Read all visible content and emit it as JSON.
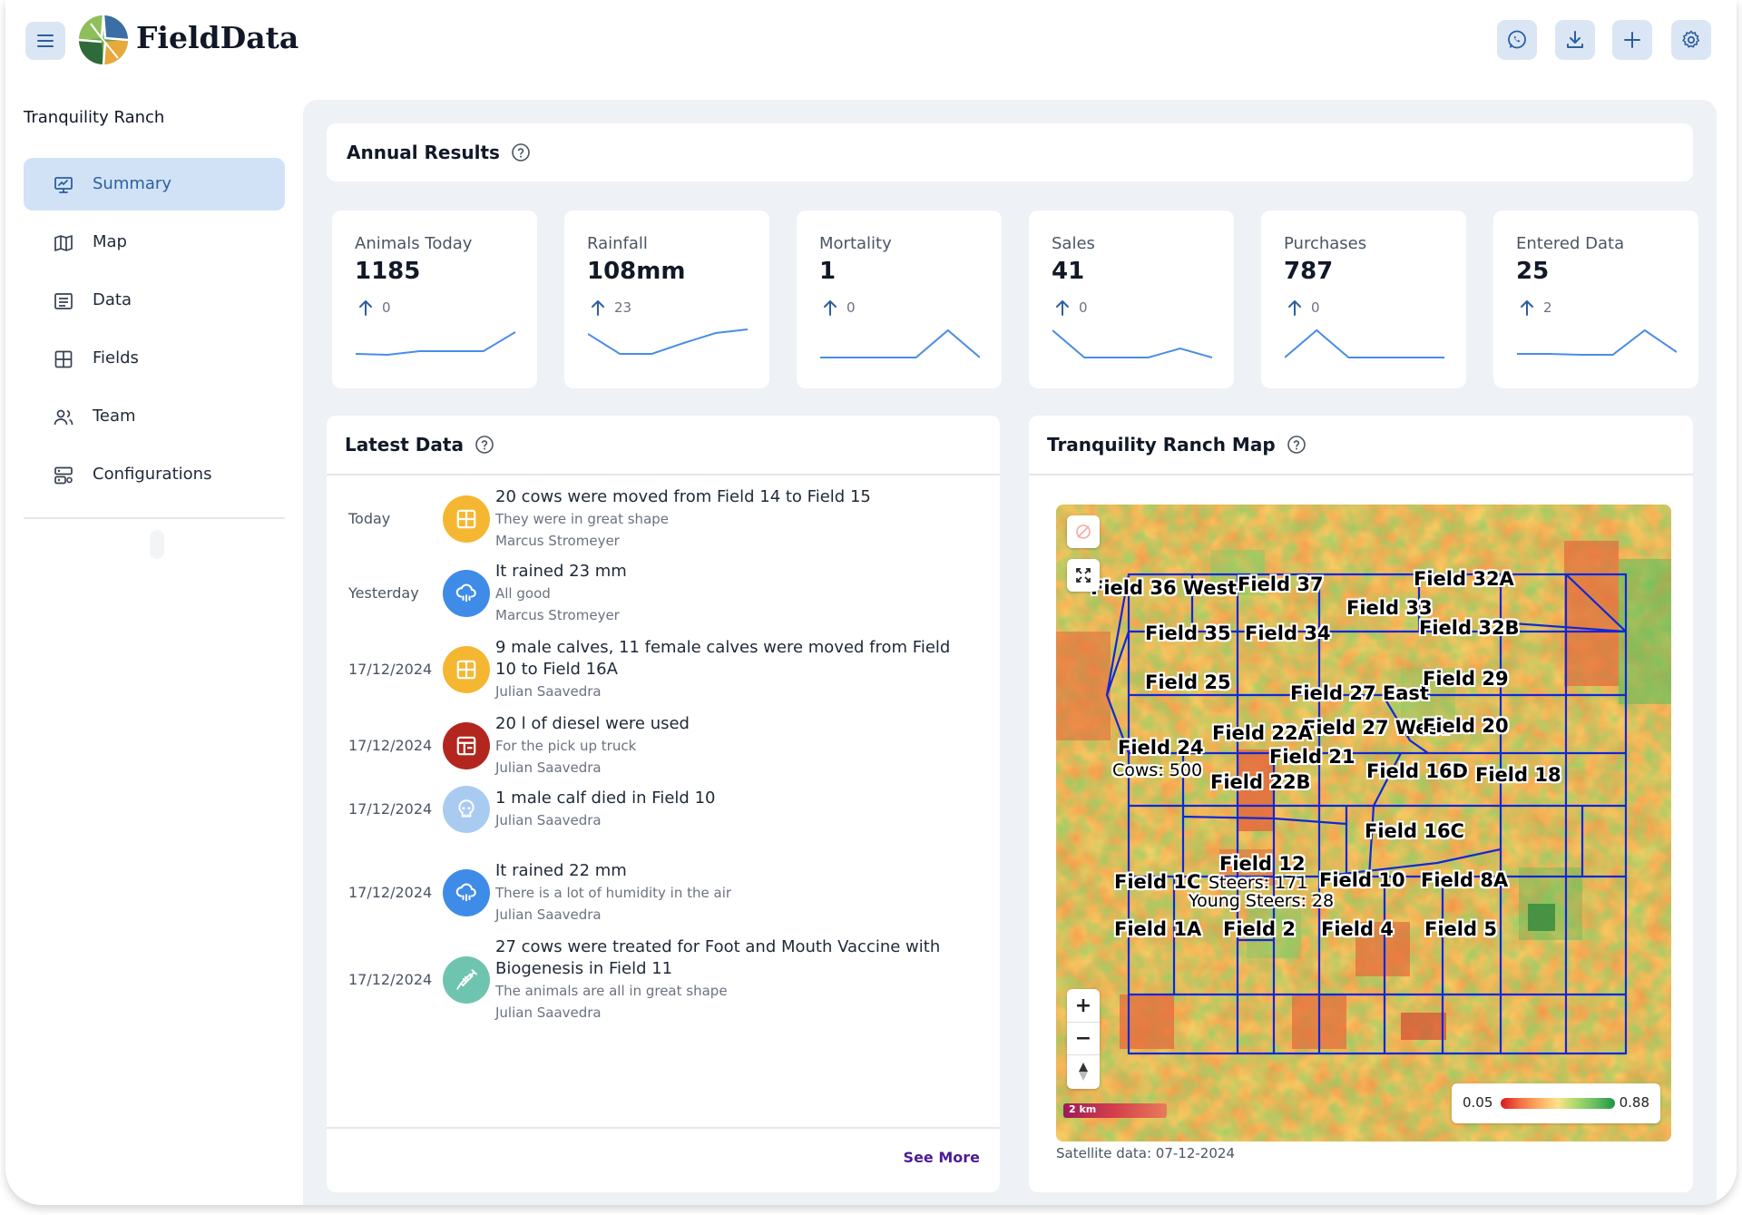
{
  "app": {
    "name": "FieldData"
  },
  "sidebar": {
    "ranch_name": "Tranquility Ranch",
    "items": [
      {
        "label": "Summary",
        "icon": "presentation-icon",
        "active": true
      },
      {
        "label": "Map",
        "icon": "map-icon"
      },
      {
        "label": "Data",
        "icon": "list-icon"
      },
      {
        "label": "Fields",
        "icon": "grid-icon"
      },
      {
        "label": "Team",
        "icon": "users-icon"
      },
      {
        "label": "Configurations",
        "icon": "server-settings-icon"
      }
    ]
  },
  "header": {
    "buttons": [
      "whatsapp-icon",
      "download-icon",
      "plus-icon",
      "gear-icon"
    ]
  },
  "annual": {
    "title": "Annual Results"
  },
  "stats": [
    {
      "label": "Animals Today",
      "value": "1185",
      "change": "0",
      "spark": [
        30,
        31,
        27,
        27,
        27,
        6
      ]
    },
    {
      "label": "Rainfall",
      "value": "108mm",
      "change": "23",
      "spark": [
        8,
        30,
        30,
        18,
        7,
        3
      ]
    },
    {
      "label": "Mortality",
      "value": "1",
      "change": "0",
      "spark": [
        34,
        34,
        34,
        34,
        4,
        34
      ]
    },
    {
      "label": "Sales",
      "value": "41",
      "change": "0",
      "spark": [
        4,
        34,
        34,
        34,
        24,
        34
      ]
    },
    {
      "label": "Purchases",
      "value": "787",
      "change": "0",
      "spark": [
        34,
        4,
        34,
        34,
        34,
        34
      ]
    },
    {
      "label": "Entered Data",
      "value": "25",
      "change": "2",
      "spark": [
        30,
        30,
        31,
        31,
        4,
        28
      ]
    }
  ],
  "latest": {
    "title": "Latest Data",
    "see_more": "See More",
    "items": [
      {
        "date": "Today",
        "icon": "grid-icon",
        "color": "#f5b731",
        "title": "20 cows were moved from Field 14 to Field 15",
        "sub": "They were in great shape",
        "author": "Marcus Stromeyer"
      },
      {
        "date": "Yesterday",
        "icon": "cloud-rain-icon",
        "color": "#3f8be8",
        "title": "It rained 23 mm",
        "sub": "All good",
        "author": "Marcus Stromeyer"
      },
      {
        "date": "17/12/2024",
        "icon": "grid-icon",
        "color": "#f5b731",
        "title": "9 male calves, 11 female calves were moved from Field 10 to Field 16A",
        "sub": "",
        "author": "Julian Saavedra"
      },
      {
        "date": "17/12/2024",
        "icon": "fuel-grid-icon",
        "color": "#b3261e",
        "title": "20 l of diesel were used",
        "sub": "For the pick up truck",
        "author": "Julian Saavedra"
      },
      {
        "date": "17/12/2024",
        "icon": "skull-icon",
        "color": "#a9cbf2",
        "title": "1 male calf died in Field 10",
        "sub": "",
        "author": "Julian Saavedra"
      },
      {
        "date": "17/12/2024",
        "icon": "cloud-rain-icon",
        "color": "#3f8be8",
        "title": "It rained 22 mm",
        "sub": "There is a lot of humidity in the air",
        "author": "Julian Saavedra"
      },
      {
        "date": "17/12/2024",
        "icon": "syringe-icon",
        "color": "#6fc4b0",
        "title": "27 cows were treated for Foot and Mouth Vaccine with Biogenesis in Field 11",
        "sub": "The animals are all in great shape",
        "author": "Julian Saavedra"
      }
    ]
  },
  "map": {
    "title": "Tranquility Ranch Map",
    "fields": [
      "Field 36 West",
      "Field 37",
      "Field 32A",
      "Field 33",
      "Field 32B",
      "Field 35",
      "Field 34",
      "Field 25",
      "Field 27 East",
      "Field 29",
      "Field 27 West",
      "Field 20",
      "Field 24",
      "Field 22A",
      "Field 21",
      "Field 22B",
      "Field 16D",
      "Field 18",
      "Field 16C",
      "Field 12",
      "Field 1C",
      "Field 10",
      "Field 8A",
      "Field 1A",
      "Field 2",
      "Field 4",
      "Field 5"
    ],
    "stats": [
      "Cows: 500",
      "Steers: 171",
      "Young Steers: 28"
    ],
    "legend_min": "0.05",
    "legend_max": "0.88",
    "scale": "2 km",
    "satellite": "Satellite data: 07-12-2024"
  }
}
